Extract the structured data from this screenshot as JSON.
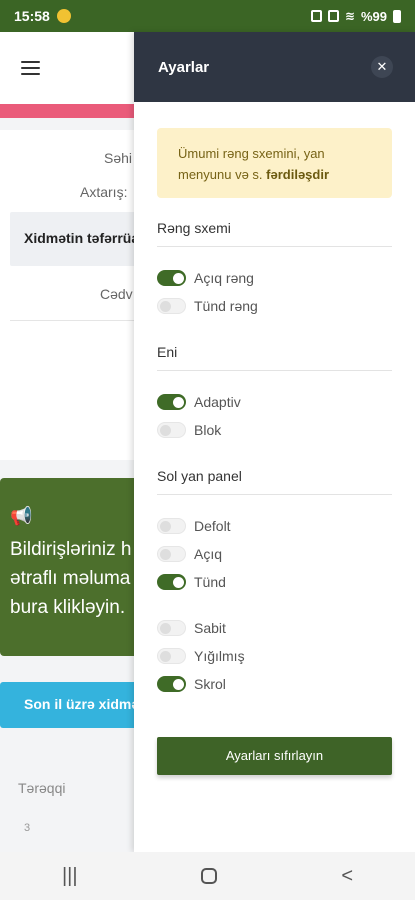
{
  "status_bar": {
    "time": "15:58",
    "battery": "%99"
  },
  "background": {
    "labels": [
      "Səhi",
      "Axtarış:",
      "Cədv"
    ],
    "detail_title": "Xidmətin təfərrüat",
    "notification_text": "Bildirişləriniz h\nətraflı məluma\nbura klikləyin.",
    "blue_button": "Son il üzrə xidmə",
    "progress_label": "Tərəqqi",
    "number": "3"
  },
  "drawer": {
    "title": "Ayarlar",
    "info_text": "Ümumi rəng sxemini, yan menyunu və s.",
    "info_bold": "fərdiləşdir",
    "sections": [
      {
        "title": "Rəng sxemi",
        "options": [
          {
            "label": "Açıq rəng",
            "on": true
          },
          {
            "label": "Tünd rəng",
            "on": false
          }
        ]
      },
      {
        "title": "Eni",
        "options": [
          {
            "label": "Adaptiv",
            "on": true
          },
          {
            "label": "Blok",
            "on": false
          }
        ]
      },
      {
        "title": "Sol yan panel",
        "options": [
          {
            "label": "Defolt",
            "on": false
          },
          {
            "label": "Açıq",
            "on": false
          },
          {
            "label": "Tünd",
            "on": true
          },
          {
            "label": "Sabit",
            "on": false
          },
          {
            "label": "Yığılmış",
            "on": false
          },
          {
            "label": "Skrol",
            "on": true
          }
        ]
      }
    ],
    "reset_button": "Ayarları sıfırlayın"
  },
  "colors": {
    "accent": "#3f6b27",
    "header": "#2f3643",
    "info_bg": "#fdf1c9"
  }
}
